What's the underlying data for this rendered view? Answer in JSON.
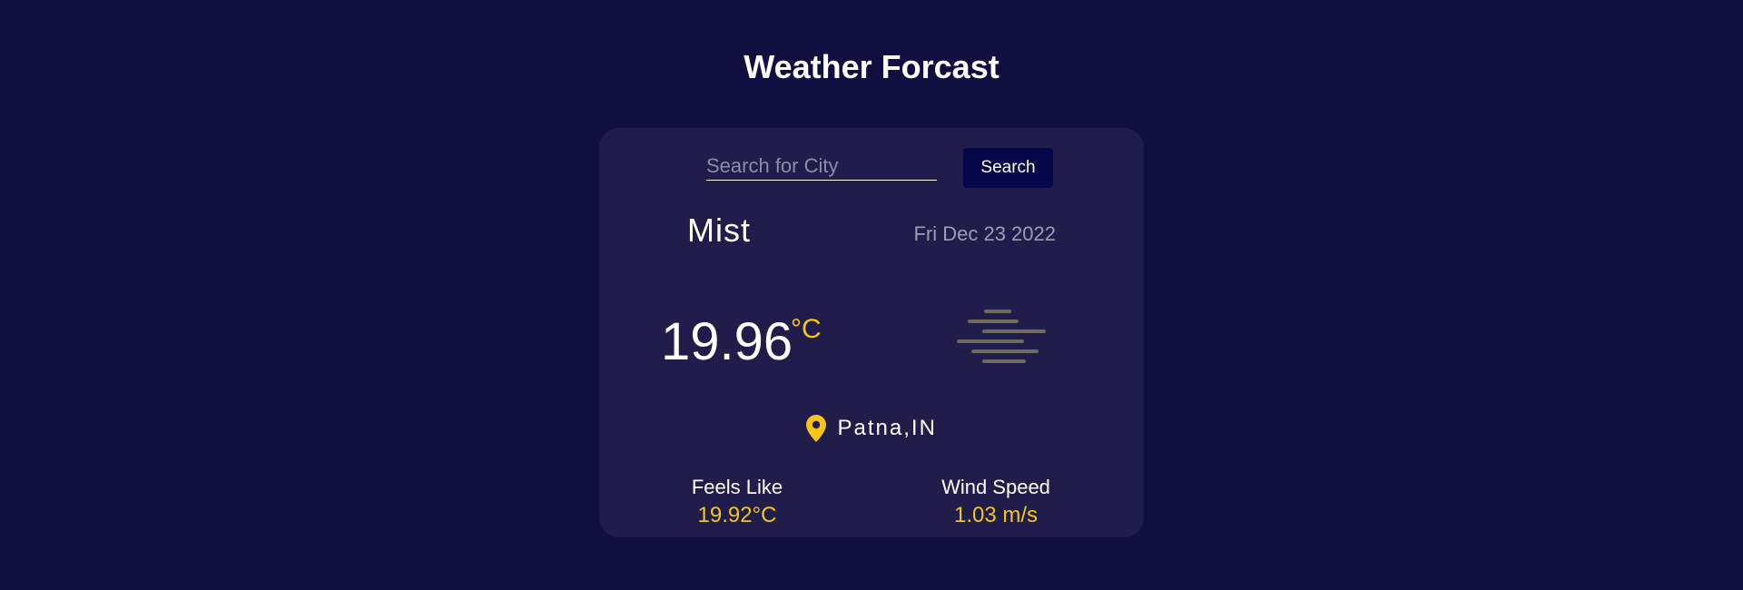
{
  "header": {
    "title": "Weather Forcast"
  },
  "search": {
    "placeholder": "Search for City",
    "value": "",
    "button_label": "Search"
  },
  "weather": {
    "condition": "Mist",
    "date": "Fri Dec 23 2022",
    "temperature": "19.96",
    "unit": "°C",
    "icon": "mist-icon",
    "location": "Patna,IN",
    "location_icon": "location-pin-icon"
  },
  "stats": {
    "feels_like": {
      "label": "Feels Like",
      "value": "19.92°C"
    },
    "wind_speed": {
      "label": "Wind Speed",
      "value": "1.03 m/s"
    }
  },
  "colors": {
    "background": "#110f40",
    "card": "#201d4a",
    "accent": "#f5c518",
    "button": "#06064a"
  }
}
